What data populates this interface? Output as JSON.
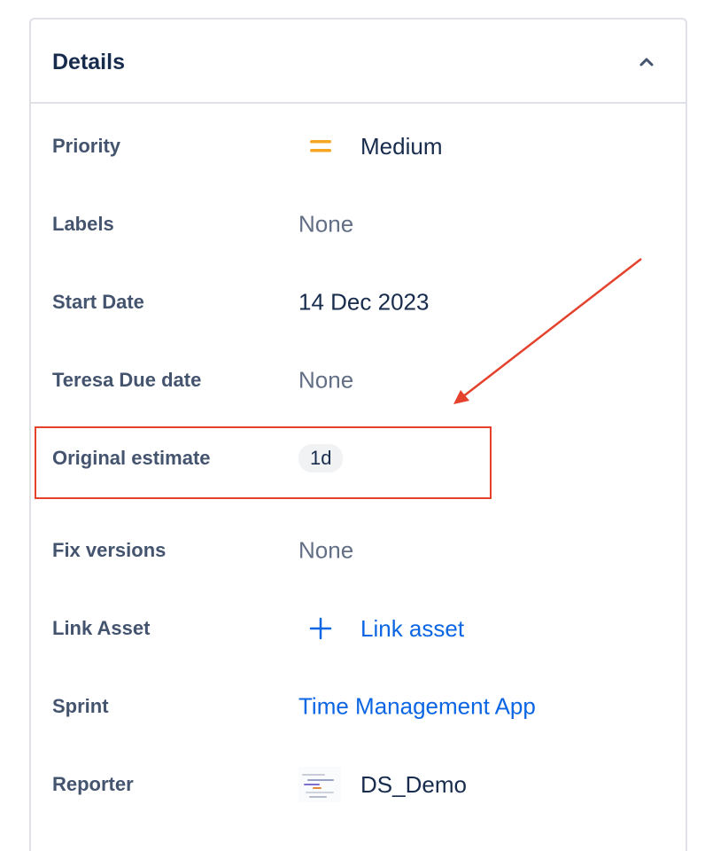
{
  "panel": {
    "title": "Details"
  },
  "fields": {
    "priority": {
      "label": "Priority",
      "value": "Medium"
    },
    "labels": {
      "label": "Labels",
      "value": "None"
    },
    "start_date": {
      "label": "Start Date",
      "value": "14 Dec 2023"
    },
    "due_date": {
      "label": "Teresa Due date",
      "value": "None"
    },
    "original_estimate": {
      "label": "Original estimate",
      "value": "1d"
    },
    "fix_versions": {
      "label": "Fix versions",
      "value": "None"
    },
    "link_asset": {
      "label": "Link Asset",
      "value": "Link asset"
    },
    "sprint": {
      "label": "Sprint",
      "value": "Time Management App"
    },
    "reporter": {
      "label": "Reporter",
      "value": "DS_Demo"
    }
  },
  "icons": {
    "collapse": "chevron-up-icon",
    "priority": "priority-medium-icon",
    "link_asset": "plus-icon",
    "reporter": "avatar"
  },
  "colors": {
    "priority_medium": "#f5a623",
    "link": "#0c66e4",
    "annotation": "#e4422d"
  }
}
